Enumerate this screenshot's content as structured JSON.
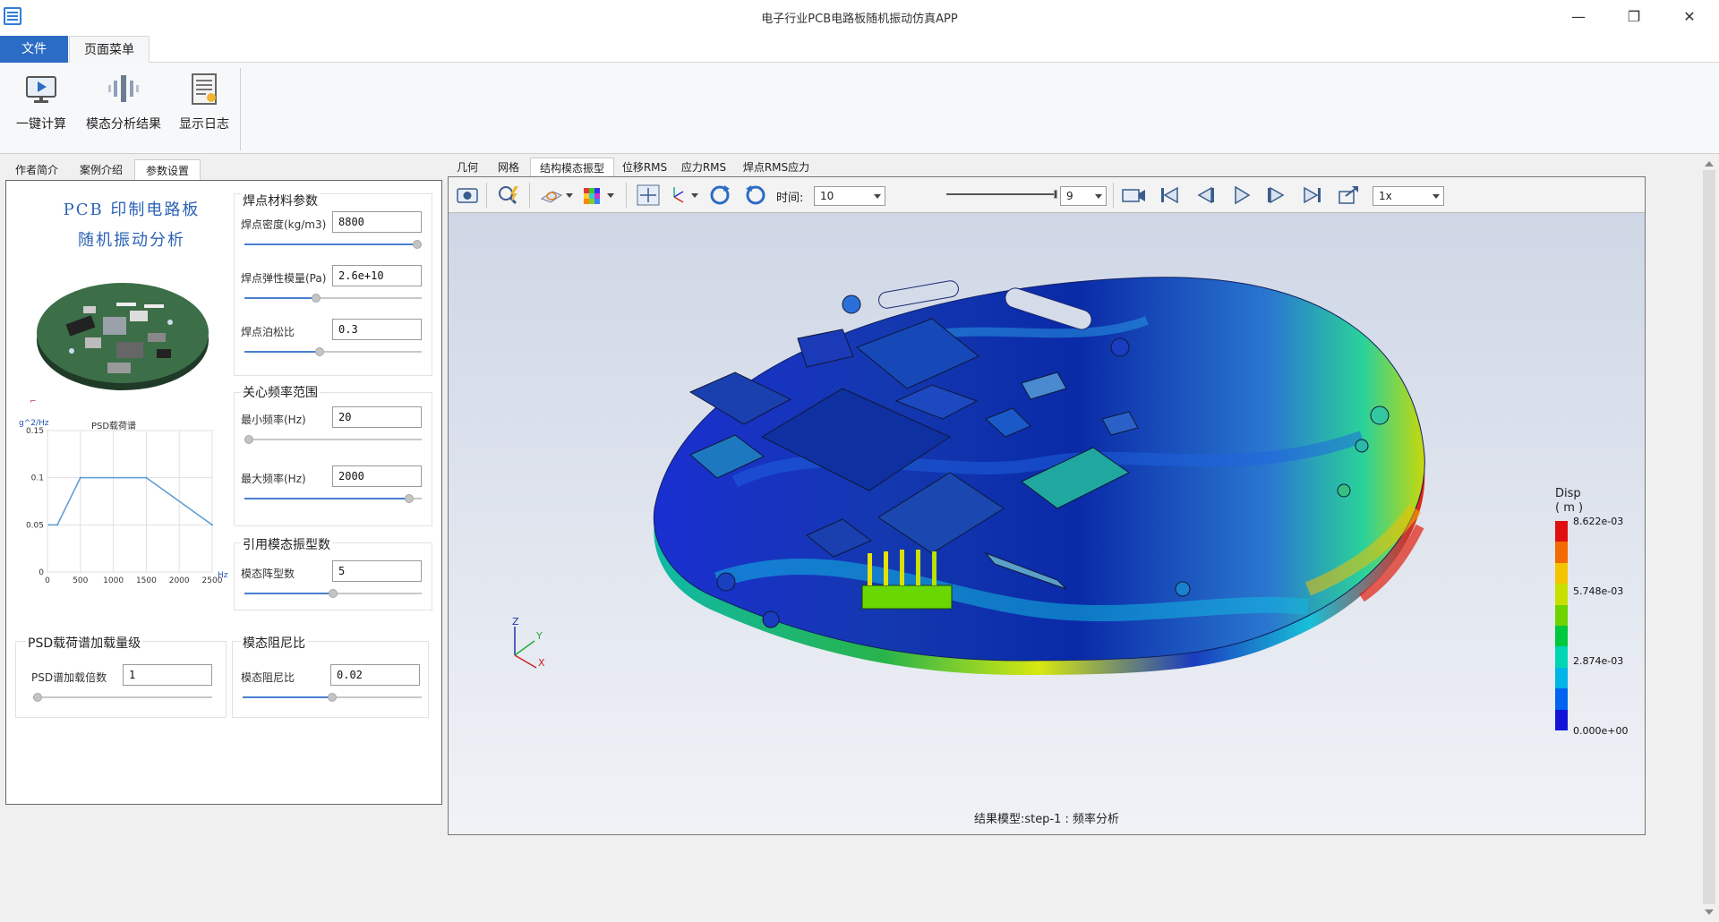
{
  "window": {
    "title": "电子行业PCB电路板随机振动仿真APP",
    "minimize": "—",
    "restore": "❐",
    "close": "✕"
  },
  "ribbon": {
    "tabs": [
      "文件",
      "页面菜单"
    ],
    "buttons": [
      {
        "label": "一键计算",
        "icon": "monitor-play-icon"
      },
      {
        "label": "模态分析结果",
        "icon": "vibration-icon"
      },
      {
        "label": "显示日志",
        "icon": "log-document-icon"
      }
    ]
  },
  "left_tabs": [
    "作者简介",
    "案例介绍",
    "参数设置"
  ],
  "left_tab_active": "参数设置",
  "pcb_title": {
    "line1": "PCB 印制电路板",
    "line2": "随机振动分析"
  },
  "psd_chart": {
    "type": "line",
    "title": "PSD载荷谱",
    "ylabel": "g^2/Hz",
    "xlabel": "Hz",
    "x_ticks": [
      "0",
      "500",
      "1000",
      "1500",
      "2000",
      "2500"
    ],
    "y_ticks": [
      "0",
      "0.05",
      "0.1",
      "0.15"
    ],
    "xlim": [
      0,
      2500
    ],
    "ylim": [
      0,
      0.15
    ],
    "x": [
      20,
      150,
      500,
      1500,
      2500
    ],
    "y": [
      0.05,
      0.05,
      0.1,
      0.1,
      0.05
    ],
    "color": "#5b9bd5",
    "grid": true
  },
  "solder_material": {
    "title": "焊点材料参数",
    "density": {
      "label": "焊点密度(kg/m3)",
      "value": "8800",
      "level": 1.0
    },
    "modulus": {
      "label": "焊点弹性模量(Pa)",
      "value": "2.6e+10",
      "level": 0.4
    },
    "poisson": {
      "label": "焊点泊松比",
      "value": "0.3",
      "level": 0.42
    }
  },
  "freq_range": {
    "title": "关心频率范围",
    "min": {
      "label": "最小频率(Hz)",
      "value": "20",
      "level": 0.0
    },
    "max": {
      "label": "最大频率(Hz)",
      "value": "2000",
      "level": 0.95
    }
  },
  "mode_count": {
    "title": "引用模态振型数",
    "field": {
      "label": "模态阵型数",
      "value": "5",
      "level": 0.5
    }
  },
  "psd_level": {
    "title": "PSD载荷谱加载量级",
    "field": {
      "label": "PSD谱加载倍数",
      "value": "1",
      "level": 0.0
    }
  },
  "damping": {
    "title": "模态阻尼比",
    "field": {
      "label": "模态阻尼比",
      "value": "0.02",
      "level": 0.5
    }
  },
  "view_tabs": [
    "几何",
    "网格",
    "结构模态振型",
    "位移RMS",
    "应力RMS",
    "焊点RMS应力"
  ],
  "view_tab_active": "结构模态振型",
  "toolbar": {
    "time_label": "时间:",
    "time_value": "10",
    "frame_value": "9",
    "speed_value": "1x",
    "frame_progress": 1.0
  },
  "result_caption": "结果模型:step-1 : 频率分析",
  "legend": {
    "title_line1": "Disp",
    "title_line2": "( m )",
    "labels": [
      "8.622e-03",
      "5.748e-03",
      "2.874e-03",
      "0.000e+00"
    ],
    "colors": [
      "#e01010",
      "#f26a00",
      "#f5c400",
      "#c8e000",
      "#6fd400",
      "#00c83c",
      "#00d6b4",
      "#00b4e8",
      "#0064f0",
      "#1414d8"
    ]
  },
  "axes": {
    "z": "Z",
    "y": "Y",
    "x": "X"
  }
}
